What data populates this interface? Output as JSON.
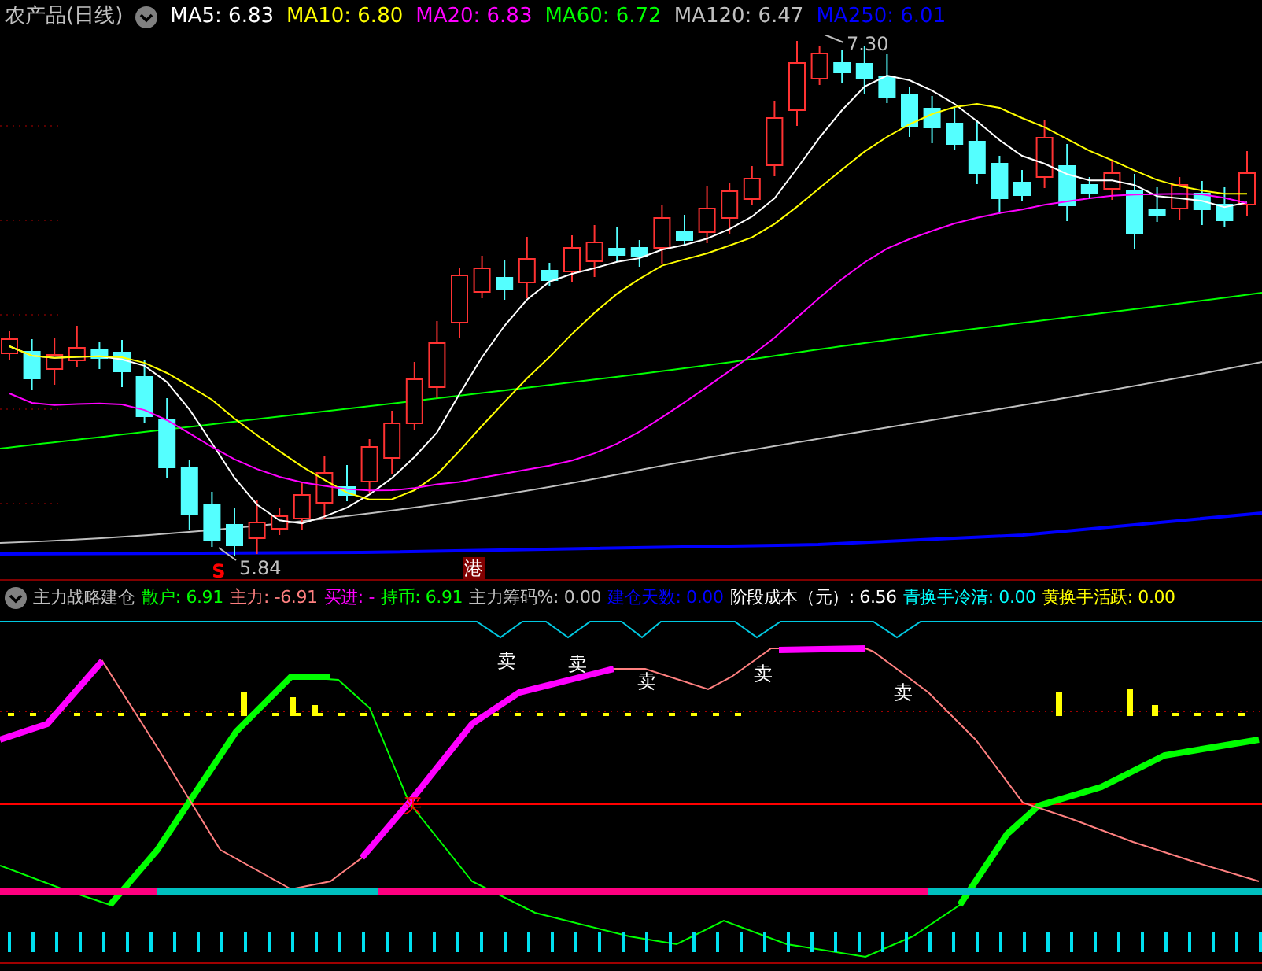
{
  "chart": {
    "title": "农产品(日线)",
    "ma_legend": [
      {
        "text": "MA5: 6.83",
        "color": "#ffffff"
      },
      {
        "text": "MA10: 6.80",
        "color": "#ffff00"
      },
      {
        "text": "MA20: 6.83",
        "color": "#ff00ff"
      },
      {
        "text": "MA60: 6.72",
        "color": "#00ff00"
      },
      {
        "text": "MA120: 6.47",
        "color": "#c0c0c0"
      },
      {
        "text": "MA250: 6.01",
        "color": "#0000ff"
      }
    ],
    "high_mark": "7.30",
    "low_mark": "5.84",
    "event_marks": [
      {
        "kind": "letter",
        "text": "S"
      },
      {
        "kind": "tag",
        "text": "港"
      }
    ]
  },
  "indicator": {
    "title": "主力战略建仓",
    "legend": [
      {
        "text": "散户: 6.91",
        "color": "#00ff00"
      },
      {
        "text": "主力: -6.91",
        "color": "#ff8080"
      },
      {
        "text": "买进: -",
        "color": "#ff00ff"
      },
      {
        "text": "持币: 6.91",
        "color": "#00ff00"
      },
      {
        "text": "主力筹码%: 0.00",
        "color": "#c0c0c0"
      },
      {
        "text": "建仓天数: 0.00",
        "color": "#0000ff"
      },
      {
        "text": "阶段成本（元）: 6.56",
        "color": "#ffffff"
      },
      {
        "text": "青换手冷清: 0.00",
        "color": "#00ffff"
      },
      {
        "text": "黄换手活跃: 0.00",
        "color": "#ffff00"
      }
    ],
    "signals": [
      {
        "kind": "sell",
        "text": "卖"
      },
      {
        "kind": "sell",
        "text": "卖"
      },
      {
        "kind": "sell",
        "text": "卖"
      },
      {
        "kind": "sell",
        "text": "卖"
      },
      {
        "kind": "sell",
        "text": "卖"
      },
      {
        "kind": "buy",
        "text": "买"
      }
    ]
  }
}
